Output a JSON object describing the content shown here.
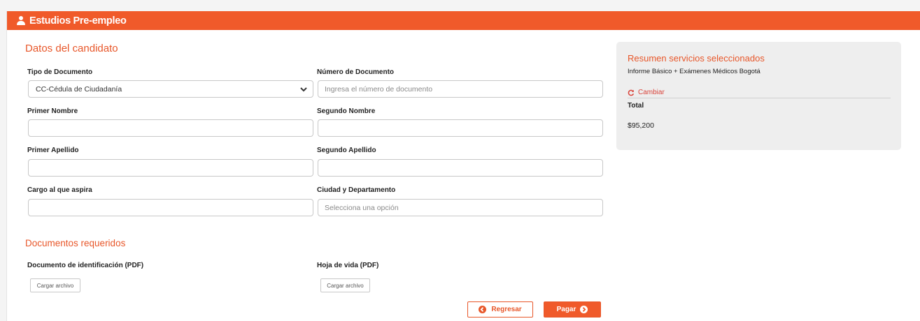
{
  "header": {
    "title": "Estudios Pre-empleo",
    "icon": "user-icon"
  },
  "candidate": {
    "section_title": "Datos del candidato",
    "doc_type": {
      "label": "Tipo de Documento",
      "selected": "CC-Cédula de Ciudadanía"
    },
    "doc_number": {
      "label": "Número de Documento",
      "placeholder": "Ingresa el número de documento",
      "value": ""
    },
    "first_name": {
      "label": "Primer Nombre",
      "value": ""
    },
    "second_name": {
      "label": "Segundo Nombre",
      "value": ""
    },
    "first_surname": {
      "label": "Primer Apellido",
      "value": ""
    },
    "second_surname": {
      "label": "Segundo Apellido",
      "value": ""
    },
    "position": {
      "label": "Cargo al que aspira",
      "value": ""
    },
    "city": {
      "label": "Ciudad y Departamento",
      "placeholder": "Selecciona una opción",
      "value": ""
    }
  },
  "documents": {
    "section_title": "Documentos requeridos",
    "id_doc": {
      "label": "Documento de identificación (PDF)",
      "button": "Cargar archivo"
    },
    "cv": {
      "label": "Hoja de vida (PDF)",
      "button": "Cargar archivo"
    }
  },
  "actions": {
    "back_label": "Regresar",
    "pay_label": "Pagar"
  },
  "summary": {
    "title": "Resumen servicios seleccionados",
    "services": "Informe Básico + Exámenes Médicos Bogotá",
    "change_label": "Cambiar",
    "total_label": "Total",
    "total_value": "$95,200"
  },
  "colors": {
    "brand": "#f05a2a",
    "accent_text": "#e8572a",
    "summary_bg": "#eeeeee"
  }
}
